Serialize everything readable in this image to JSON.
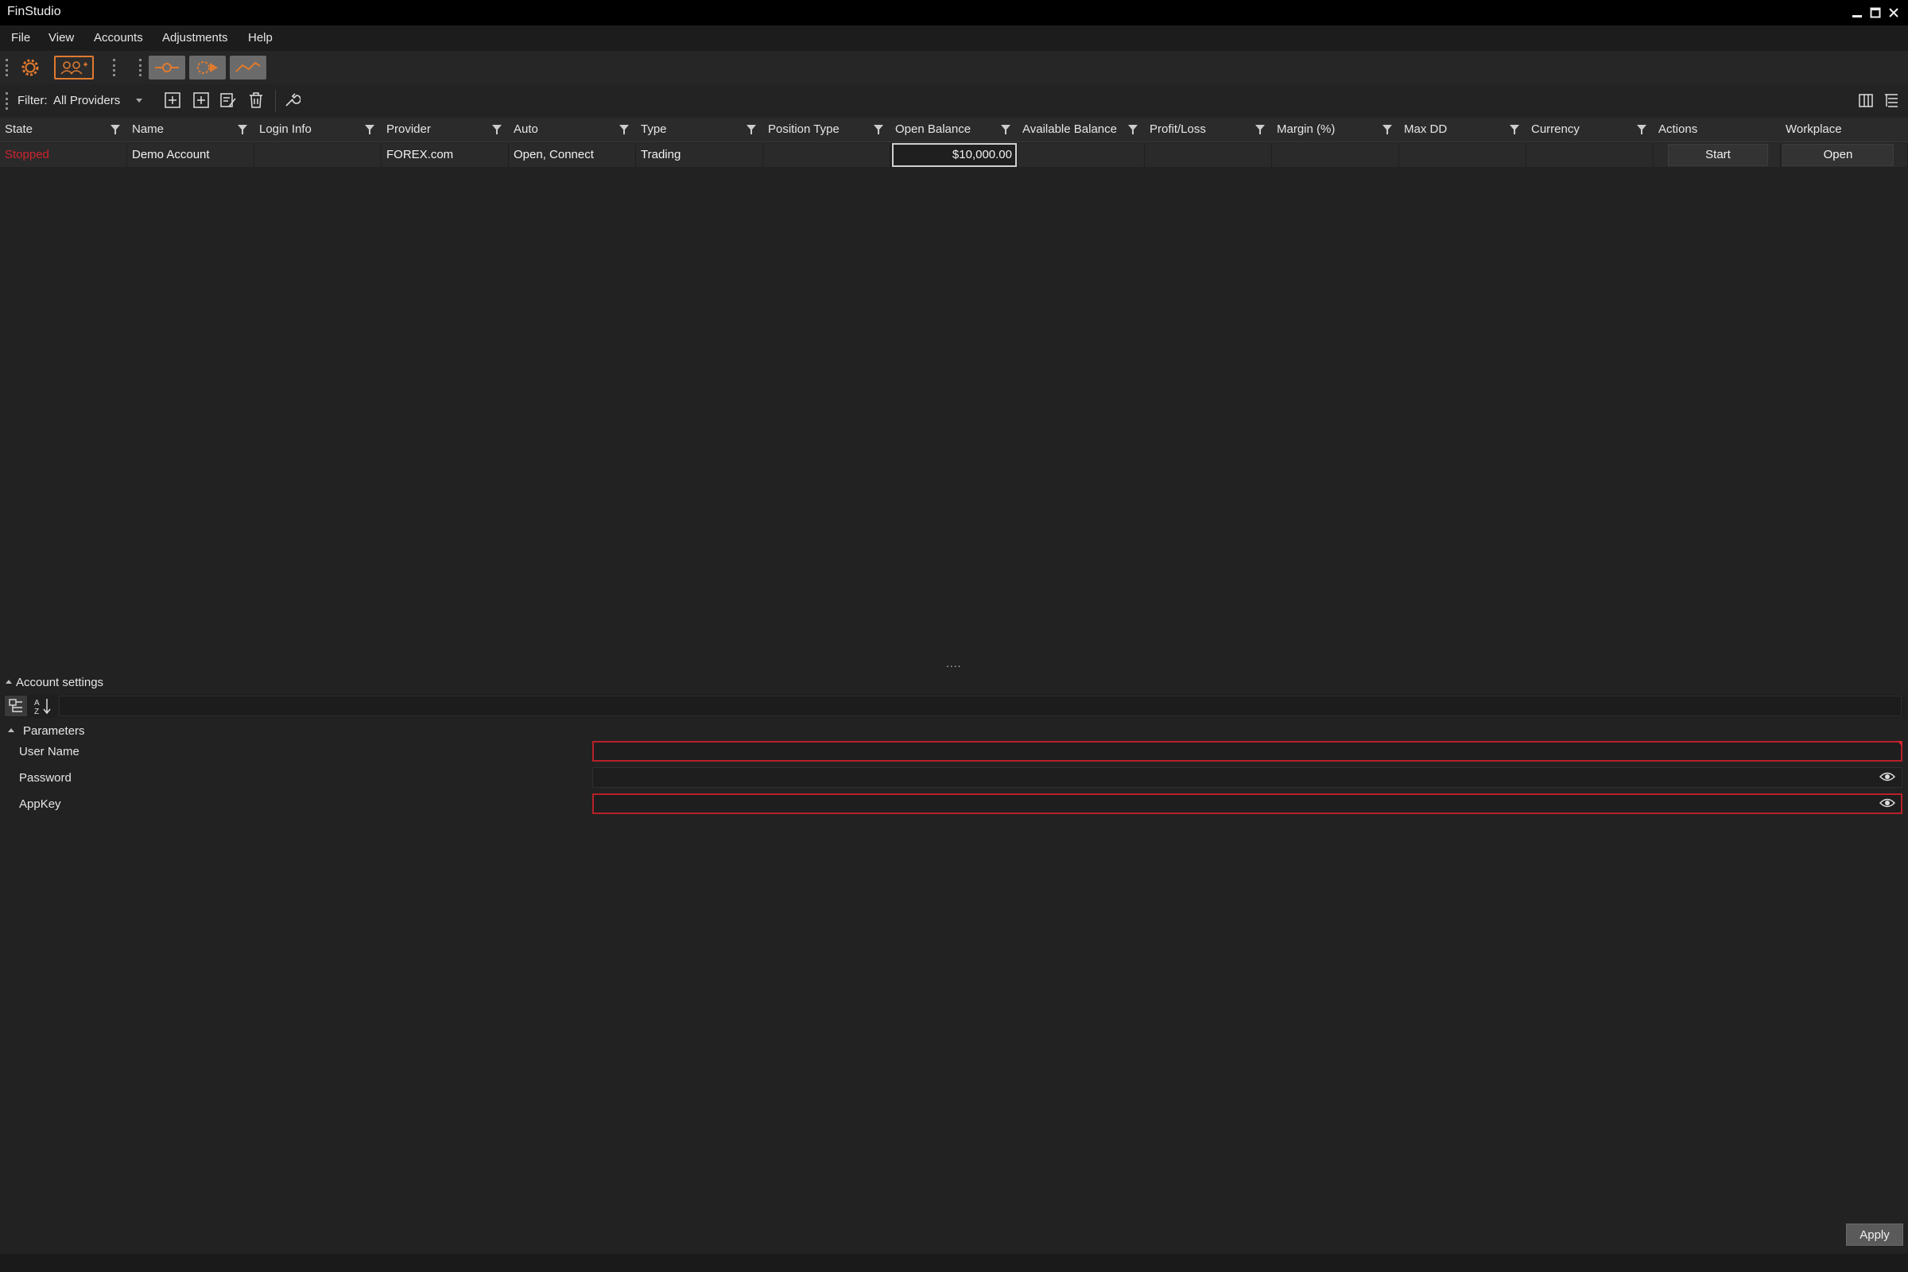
{
  "window": {
    "title": "FinStudio",
    "minimize": "–",
    "maximize": "□",
    "close": "✕"
  },
  "menu": [
    "File",
    "View",
    "Accounts",
    "Adjustments",
    "Help"
  ],
  "toolbar": {
    "icons": [
      "settings-gear-icon",
      "accounts-icon",
      "connect-icon",
      "strategy-icon",
      "chart-icon"
    ],
    "accent": "#e07a2e"
  },
  "filter": {
    "label": "Filter:",
    "value": "All Providers"
  },
  "grid": {
    "columns": [
      "State",
      "Name",
      "Login Info",
      "Provider",
      "Auto",
      "Type",
      "Position Type",
      "Open Balance",
      "Available Balance",
      "Profit/Loss",
      "Margin (%)",
      "Max DD",
      "Currency",
      "Actions",
      "Workplace"
    ],
    "rows": [
      {
        "state": "Stopped",
        "name": "Demo Account",
        "login_info": "",
        "provider": "FOREX.com",
        "auto": "Open, Connect",
        "type": "Trading",
        "position_type": "",
        "open_balance": "$10,000.00",
        "available_balance": "",
        "profit_loss": "",
        "margin": "",
        "max_dd": "",
        "currency": "",
        "action": "Start",
        "workplace": "Open"
      }
    ],
    "state_color": "#d0242e"
  },
  "splitter": "....",
  "settings": {
    "title": "Account settings",
    "group": "Parameters",
    "fields": [
      {
        "label": "User Name",
        "value": ""
      },
      {
        "label": "Password",
        "value": ""
      },
      {
        "label": "AppKey",
        "value": ""
      }
    ],
    "apply_label": "Apply"
  }
}
